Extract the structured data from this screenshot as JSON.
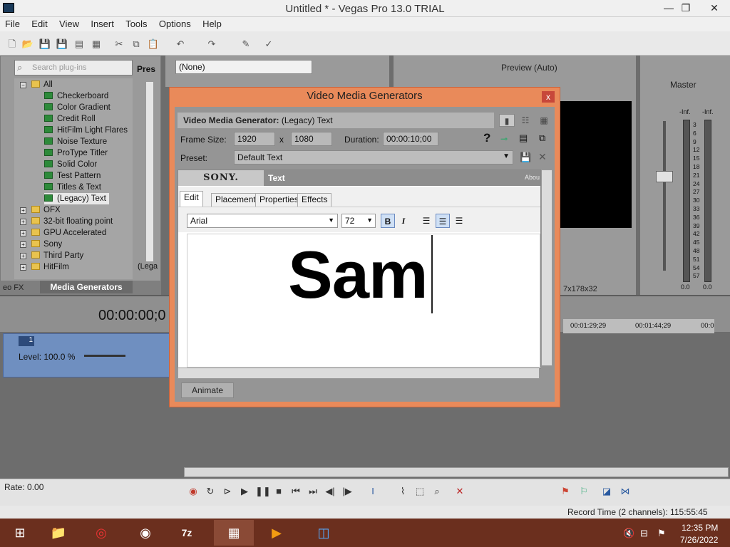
{
  "window": {
    "title": "Untitled * - Vegas Pro 13.0 TRIAL",
    "minimize": "—",
    "maximize": "❐",
    "close": "✕"
  },
  "menu": [
    "File",
    "Edit",
    "View",
    "Insert",
    "Tools",
    "Options",
    "Help"
  ],
  "explorer": {
    "search_placeholder": "Search plug-ins",
    "presets_label": "Pres",
    "preset_item": "(Lega",
    "tree": [
      {
        "label": "All",
        "type": "folder",
        "level": 0,
        "expanded": true
      },
      {
        "label": "Checkerboard",
        "type": "generator",
        "level": 1
      },
      {
        "label": "Color Gradient",
        "type": "generator",
        "level": 1
      },
      {
        "label": "Credit Roll",
        "type": "generator",
        "level": 1
      },
      {
        "label": "HitFilm Light Flares",
        "type": "generator",
        "level": 1
      },
      {
        "label": "Noise Texture",
        "type": "generator",
        "level": 1
      },
      {
        "label": "ProType Titler",
        "type": "generator",
        "level": 1
      },
      {
        "label": "Solid Color",
        "type": "generator",
        "level": 1
      },
      {
        "label": "Test Pattern",
        "type": "generator",
        "level": 1
      },
      {
        "label": "Titles & Text",
        "type": "generator",
        "level": 1
      },
      {
        "label": "(Legacy) Text",
        "type": "generator",
        "level": 1,
        "selected": true
      },
      {
        "label": "OFX",
        "type": "folder",
        "level": 0
      },
      {
        "label": "32-bit floating point",
        "type": "folder",
        "level": 0
      },
      {
        "label": "GPU Accelerated",
        "type": "folder",
        "level": 0
      },
      {
        "label": "Sony",
        "type": "folder",
        "level": 0
      },
      {
        "label": "Third Party",
        "type": "folder",
        "level": 0
      },
      {
        "label": "HitFilm",
        "type": "folder",
        "level": 0
      }
    ],
    "tab_fx": "eo FX",
    "tab_media": "Media Generators"
  },
  "center": {
    "media_select": "(None)"
  },
  "preview": {
    "mode": "Preview (Auto)",
    "dims": "7x178x32"
  },
  "mixer": {
    "master": "Master",
    "inf_left": "-Inf.",
    "inf_right": "-Inf.",
    "scale": [
      "3",
      "6",
      "9",
      "12",
      "15",
      "18",
      "21",
      "24",
      "27",
      "30",
      "33",
      "36",
      "39",
      "42",
      "45",
      "48",
      "51",
      "54",
      "57"
    ],
    "val_left": "0.0",
    "val_right": "0.0"
  },
  "timeline": {
    "timecode": "00:00:00;0",
    "track_number": "1",
    "level": "Level: 100.0 %",
    "ruler": [
      "00:01:29;29",
      "00:01:44;29",
      "00:0"
    ],
    "rate": "Rate: 0.00"
  },
  "status": {
    "record_time": "Record Time (2 channels): 115:55:45"
  },
  "taskbar": {
    "time": "12:35 PM",
    "date": "7/26/2022",
    "app_7z": "7z"
  },
  "dialog": {
    "title": "Video Media Generators",
    "close": "x",
    "generator_label": "Video Media Generator:",
    "generator_value": "(Legacy) Text",
    "frame_size_label": "Frame Size:",
    "width": "1920",
    "x": "x",
    "height": "1080",
    "duration_label": "Duration:",
    "duration": "00:00:10;00",
    "preset_label": "Preset:",
    "preset_value": "Default Text",
    "sony": "SONY.",
    "text_header": "Text",
    "about": "Abou",
    "tabs": [
      "Edit",
      "Placement",
      "Properties",
      "Effects"
    ],
    "font": "Arial",
    "size": "72",
    "bold": "B",
    "italic": "I",
    "editor_text": "Sam",
    "animate": "Animate"
  }
}
